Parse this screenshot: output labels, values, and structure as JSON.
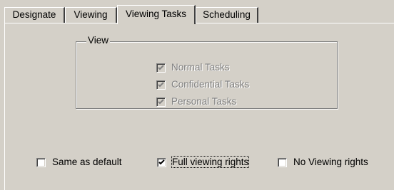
{
  "tabs": [
    {
      "label": "Designate"
    },
    {
      "label": "Viewing"
    },
    {
      "label": "Viewing Tasks"
    },
    {
      "label": "Scheduling"
    }
  ],
  "view_group": {
    "title": "View",
    "options": [
      {
        "label": "Normal Tasks",
        "checked": true,
        "disabled": true
      },
      {
        "label": "Confidential Tasks",
        "checked": true,
        "disabled": true
      },
      {
        "label": "Personal Tasks",
        "checked": true,
        "disabled": true
      }
    ]
  },
  "rights": {
    "same_as_default": {
      "label": "Same as default",
      "checked": false
    },
    "full_viewing_rights": {
      "label": "Full viewing rights",
      "checked": true
    },
    "no_viewing_rights": {
      "label": "No Viewing rights",
      "checked": false
    }
  }
}
